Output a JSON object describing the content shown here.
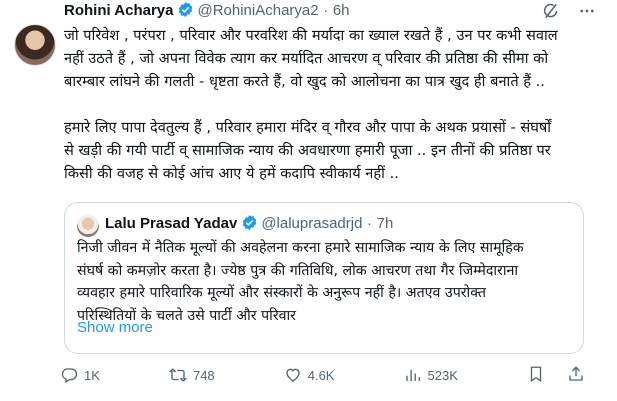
{
  "tweet": {
    "author_name": "Rohini Acharya",
    "handle": "@RohiniAcharya2",
    "separator": "·",
    "time": "6h",
    "text": "जो परिवेश , परंपरा , परिवार और परवरिश की मर्यादा का ख्याल रखते हैं , उन पर कभी सवाल\nनहीं उठते हैं , जो अपना विवेक त्याग कर मर्यादित आचरण व् परिवार की प्रतिष्ठा की सीमा को\nबारम्बार लांघने की गलती - धृष्टता करते हैं, वो खुद को आलोचना का पात्र खुद ही बनाते हैं ..\n\nहमारे लिए पापा देवतुल्य हैं , परिवार हमारा मंदिर व् गौरव और पापा के अथक प्रयासों - संघर्षों\nसे खड़ी की गयी पार्टी व् सामाजिक न्याय की अवधारणा हमारी पूजा .. इन तीनों की प्रतिष्ठा पर\nकिसी की वजह से कोई आंच आए ये हमें कदापि स्वीकार्य नहीं .."
  },
  "quote": {
    "author_name": "Lalu Prasad Yadav",
    "handle": "@laluprasadrjd",
    "separator": "·",
    "time": "7h",
    "text": "निजी जीवन में नैतिक मूल्यों की अवहेलना करना हमारे सामाजिक न्याय के लिए सामूहिक\nसंघर्ष को कमज़ोर करता है। ज्येष्ठ पुत्र की गतिविधि, लोक आचरण तथा गैर जिम्मेदाराना\nव्यवहार हमारे पारिवारिक मूल्यों और संस्कारों के अनुरूप नहीं है। अतएव उपरोक्त\nपरिस्थितियों के चलते उसे पार्टी और परिवार",
    "show_more": "Show more"
  },
  "actions": {
    "replies": "1K",
    "reposts": "748",
    "likes": "4.6K",
    "views": "523K"
  },
  "colors": {
    "secondary_text": "#536471",
    "link": "#1d9bf0",
    "verified_badge": "#1d9bf0",
    "border": "#cfd9de"
  },
  "icons": [
    "verified-badge-icon",
    "grok-icon",
    "more-icon",
    "reply-icon",
    "repost-icon",
    "like-icon",
    "views-icon",
    "bookmark-icon",
    "share-icon"
  ]
}
